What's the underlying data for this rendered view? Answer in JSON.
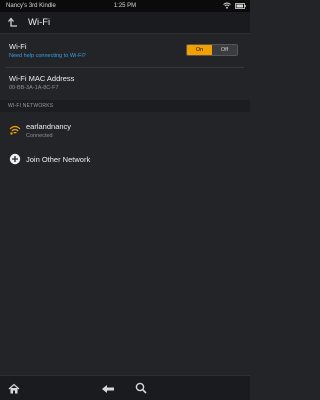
{
  "status_bar": {
    "device_name": "Nancy's 3rd Kindle",
    "time": "1:25 PM"
  },
  "header": {
    "title": "Wi-Fi"
  },
  "wifi": {
    "label": "Wi-Fi",
    "help_link": "Need help connecting to Wi-Fi?",
    "toggle_on": "On",
    "toggle_off": "Off",
    "state": "On",
    "accent": "#f2a000"
  },
  "mac": {
    "label": "Wi-Fi MAC Address",
    "value": "00-BB-3A-1A-8C-F7"
  },
  "networks": {
    "section_title": "WI-FI NETWORKS",
    "items": [
      {
        "name": "earlandnancy",
        "status": "Connected",
        "icon": "wifi-signal-icon"
      }
    ],
    "join_label": "Join Other Network"
  },
  "nav": {
    "home_icon": "home-icon",
    "back_icon": "back-arrow-icon",
    "search_icon": "search-icon"
  }
}
